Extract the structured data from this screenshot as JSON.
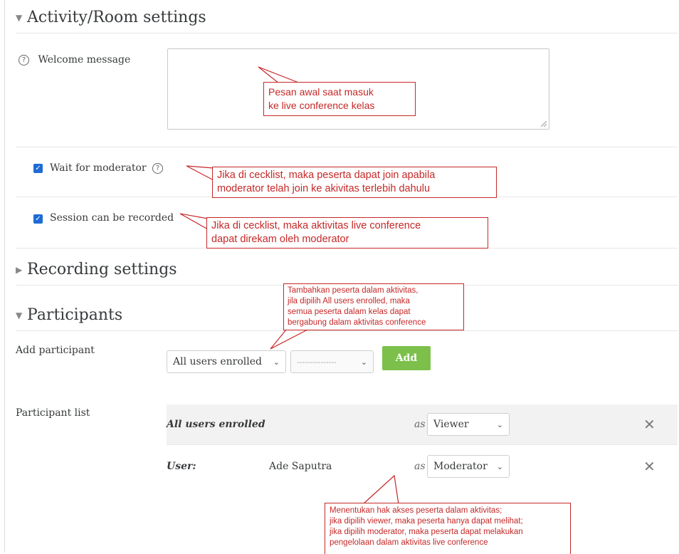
{
  "sections": {
    "activity_room": {
      "title": "Activity/Room settings"
    },
    "recording": {
      "title": "Recording settings"
    },
    "participants": {
      "title": "Participants"
    }
  },
  "welcome": {
    "label": "Welcome message",
    "value": ""
  },
  "checkboxes": {
    "wait_for_moderator": {
      "label": "Wait for moderator",
      "checked": true
    },
    "session_recorded": {
      "label": "Session can be recorded",
      "checked": true
    }
  },
  "add_participant": {
    "label": "Add participant",
    "select1": "All users enrolled",
    "select2": "---------------",
    "button": "Add"
  },
  "participant_list": {
    "label": "Participant list",
    "as_word": "as",
    "rows": [
      {
        "type_label": "All users enrolled",
        "name": "",
        "role": "Viewer"
      },
      {
        "type_label": "User:",
        "name": "Ade Saputra",
        "role": "Moderator"
      }
    ]
  },
  "annotations": {
    "welcome": [
      "Pesan awal saat masuk",
      "ke live conference kelas"
    ],
    "wait": [
      "Jika di cecklist, maka peserta dapat join apabila",
      "moderator telah join ke akivitas terlebih dahulu"
    ],
    "recorded": [
      "Jika di cecklist, maka aktivitas live conference",
      "dapat direkam oleh moderator"
    ],
    "participants": [
      "Tambahkan peserta dalam aktivitas,",
      "jila dipilih All users enrolled, maka",
      "semua peserta dalam kelas dapat",
      "bergabung dalam aktivitas conference"
    ],
    "roles": [
      "Menentukan hak akses peserta dalam aktivitas;",
      "jika dipilih viewer, maka peserta hanya dapat melihat;",
      "jika dipilih moderator, maka peserta dapat melakukan",
      "pengelolaan dalam aktivitas live conference"
    ]
  },
  "colors": {
    "annotation": "#c62828",
    "checkbox": "#1e6bd6",
    "add_button": "#7cc04b",
    "row_bg": "#f2f2f2"
  }
}
